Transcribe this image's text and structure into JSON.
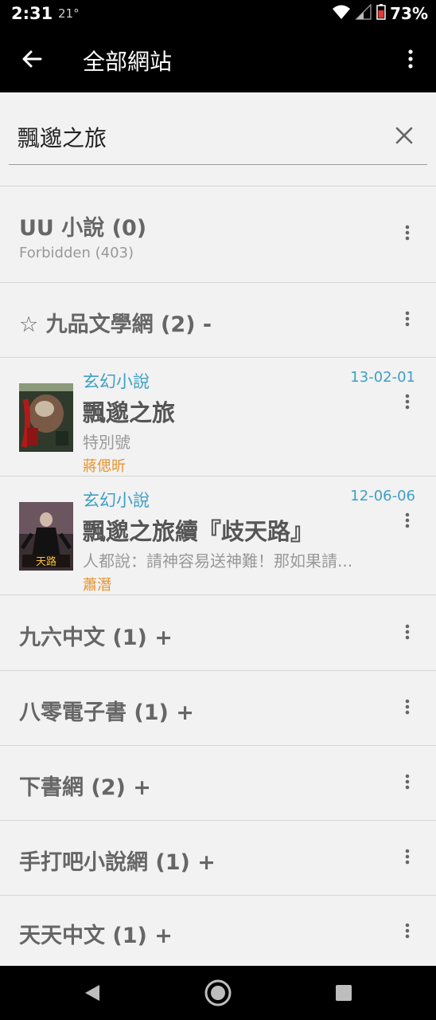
{
  "status": {
    "time": "2:31",
    "temp": "21°",
    "battery": "73%"
  },
  "appbar": {
    "title": "全部網站"
  },
  "search": {
    "query": "飄邈之旅"
  },
  "sites": [
    {
      "title": "UU 小說 (0)",
      "subtitle": "Forbidden (403)"
    },
    {
      "title": "☆ 九品文學網 (2) -"
    },
    {
      "title": "九六中文 (1) +"
    },
    {
      "title": "八零電子書 (1) +"
    },
    {
      "title": "下書網 (2) +"
    },
    {
      "title": "手打吧小說網 (1) +"
    },
    {
      "title": "天天中文 (1) +"
    }
  ],
  "books": [
    {
      "category": "玄幻小說",
      "date": "13-02-01",
      "title": "飄邈之旅",
      "description": "特別號",
      "author": "蔣偲昕"
    },
    {
      "category": "玄幻小說",
      "date": "12-06-06",
      "title": "飄邈之旅續『歧天路』",
      "description": "人都說：請神容易送神難！那如果請...",
      "author": "蕭潛"
    }
  ],
  "colors": {
    "accent_blue": "#3f9fc4",
    "author_orange": "#e8922e",
    "bar_black": "#000000"
  },
  "icons": [
    "back-arrow-icon",
    "more-vert-icon",
    "close-icon",
    "wifi-icon",
    "signal-icon",
    "battery-icon",
    "nav-back-icon",
    "nav-home-icon",
    "nav-recents-icon"
  ]
}
